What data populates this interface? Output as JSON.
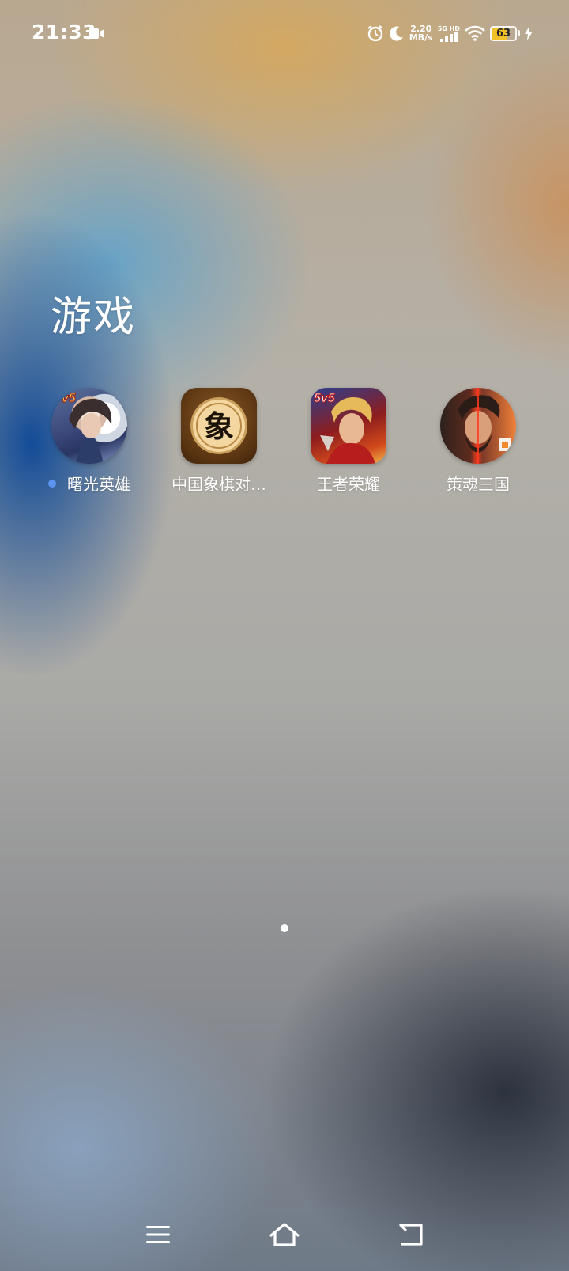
{
  "status_bar": {
    "time": "21:33",
    "speed_value": "2.20",
    "speed_unit": "MB/s",
    "network_type": "5G",
    "network_quality": "HD",
    "battery_level": "63",
    "battery_percent": 63,
    "icons": [
      "screen-record-icon",
      "alarm-icon",
      "moon-icon",
      "signal-icon",
      "wifi-icon",
      "battery-icon",
      "charging-icon"
    ]
  },
  "folder": {
    "title": "游戏",
    "apps": [
      {
        "label": "曙光英雄",
        "badge": "5v5",
        "has_new_dot": true,
        "icon": "hero-portrait-icon"
      },
      {
        "label": "中国象棋对…",
        "glyph": "象",
        "icon": "chess-piece-icon"
      },
      {
        "label": "王者荣耀",
        "badge": "5v5",
        "icon": "hero-portrait-icon"
      },
      {
        "label": "策魂三国",
        "icon": "warrior-portrait-icon"
      }
    ]
  },
  "navigation": {
    "buttons": [
      "menu-icon",
      "home-icon",
      "back-icon"
    ]
  }
}
